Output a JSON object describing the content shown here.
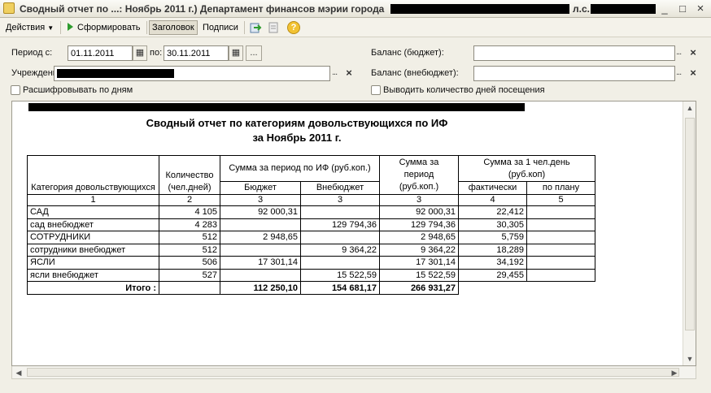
{
  "window": {
    "title": "Сводный отчет по ...: Ноябрь 2011 г.) Департамент финансов мэрии города",
    "title_suffix": "л.с.",
    "min": "_",
    "max": "□",
    "close": "×"
  },
  "toolbar": {
    "actions": "Действия",
    "generate": "Сформировать",
    "header": "Заголовок",
    "signatures": "Подписи",
    "help": "?"
  },
  "form": {
    "period_from_label": "Период с:",
    "period_from": "01.11.2011",
    "period_to_label": "по:",
    "period_to": "30.11.2011",
    "institution_label": "Учреждение",
    "balance_budget_label": "Баланс (бюджет):",
    "balance_extrabudget_label": "Баланс (внебюджет):",
    "decode_by_days": "Расшифровывать по дням",
    "show_visit_days": "Выводить количество дней посещения",
    "dots": "...",
    "clear": "×"
  },
  "report": {
    "title_line1": "Сводный отчет по категориям довольствующихся по ИФ",
    "title_line2": "за Ноябрь 2011 г.",
    "headers": {
      "category": "Категория довольствующихся",
      "count": "Количество (чел.дней)",
      "sum_if": "Сумма  за период по ИФ (руб.коп.)",
      "budget": "Бюджет",
      "extrabudget": "Внебюджет",
      "sum_period": "Сумма за период (руб.коп.)",
      "sum_per_person": "Сумма за 1 чел.день (руб.коп)",
      "actual": "фактически",
      "planned": "по плану"
    },
    "col_numbers": [
      "1",
      "2",
      "3",
      "3",
      "3",
      "4",
      "5"
    ],
    "rows": [
      {
        "category": "САД",
        "count": "4 105",
        "budget": "92 000,31",
        "extrabudget": "",
        "total": "92 000,31",
        "actual": "22,412",
        "planned": ""
      },
      {
        "category": "сад внебюджет",
        "count": "4 283",
        "budget": "",
        "extrabudget": "129 794,36",
        "total": "129 794,36",
        "actual": "30,305",
        "planned": ""
      },
      {
        "category": "СОТРУДНИКИ",
        "count": "512",
        "budget": "2 948,65",
        "extrabudget": "",
        "total": "2 948,65",
        "actual": "5,759",
        "planned": ""
      },
      {
        "category": "сотрудники внебюджет",
        "count": "512",
        "budget": "",
        "extrabudget": "9 364,22",
        "total": "9 364,22",
        "actual": "18,289",
        "planned": ""
      },
      {
        "category": "ЯСЛИ",
        "count": "506",
        "budget": "17 301,14",
        "extrabudget": "",
        "total": "17 301,14",
        "actual": "34,192",
        "planned": ""
      },
      {
        "category": "ясли внебюджет",
        "count": "527",
        "budget": "",
        "extrabudget": "15 522,59",
        "total": "15 522,59",
        "actual": "29,455",
        "planned": ""
      }
    ],
    "totals": {
      "label": "Итого :",
      "budget": "112 250,10",
      "extrabudget": "154 681,17",
      "total": "266 931,27"
    }
  },
  "colors": {
    "window_bg": "#f1efe6",
    "accent_green": "#2e9b2e"
  }
}
